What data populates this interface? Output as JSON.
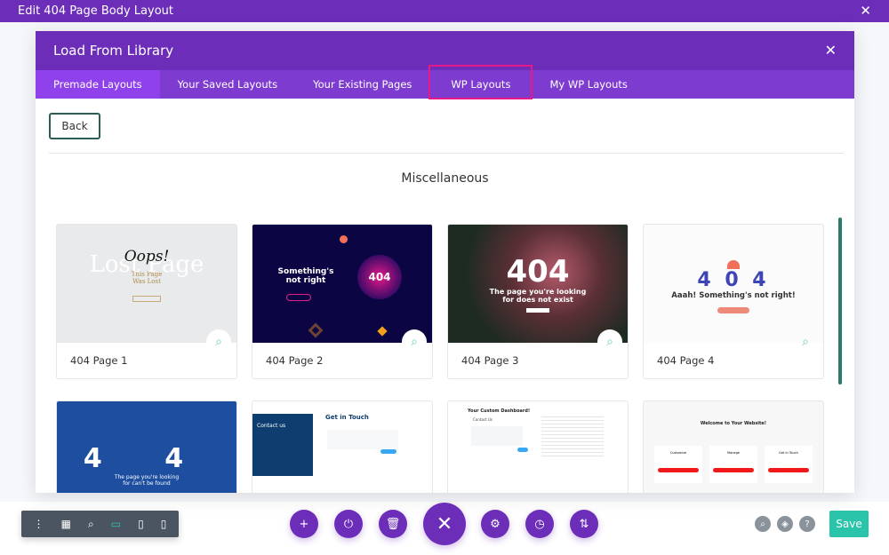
{
  "window": {
    "title": "Edit 404 Page Body Layout"
  },
  "modal": {
    "title": "Load From Library",
    "tabs": [
      {
        "label": "Premade Layouts",
        "active": true
      },
      {
        "label": "Your Saved Layouts"
      },
      {
        "label": "Your Existing Pages"
      },
      {
        "label": "WP Layouts",
        "highlighted": true
      },
      {
        "label": "My WP Layouts"
      }
    ],
    "back_label": "Back",
    "section_title": "Miscellaneous",
    "cards": [
      {
        "label": "404 Page 1",
        "thumb": [
          "Lost Page",
          "Oops!",
          "This Page Was Lost"
        ]
      },
      {
        "label": "404 Page 2",
        "thumb": [
          "Something's not right",
          "404"
        ]
      },
      {
        "label": "404 Page 3",
        "thumb": [
          "404",
          "The page you're looking for does not exist"
        ]
      },
      {
        "label": "404 Page 4",
        "thumb": [
          "4 0 4",
          "Aaah! Something's not right!"
        ]
      },
      {
        "label": "",
        "thumb": [
          "4 4",
          "The page you're looking for can't be found"
        ]
      },
      {
        "label": "",
        "thumb": [
          "Contact us",
          "Get in Touch"
        ]
      },
      {
        "label": "",
        "thumb": [
          "Your Custom Dashboard!",
          "Contact Us"
        ]
      },
      {
        "label": "",
        "thumb": [
          "Welcome to Your Website!",
          "Customize",
          "Manage",
          "Get In Touch"
        ]
      }
    ]
  },
  "toolbar": {
    "save_label": "Save",
    "accent": "#6c2eb9",
    "save_color": "#29c4a9",
    "highlight_color": "#e5198a"
  }
}
